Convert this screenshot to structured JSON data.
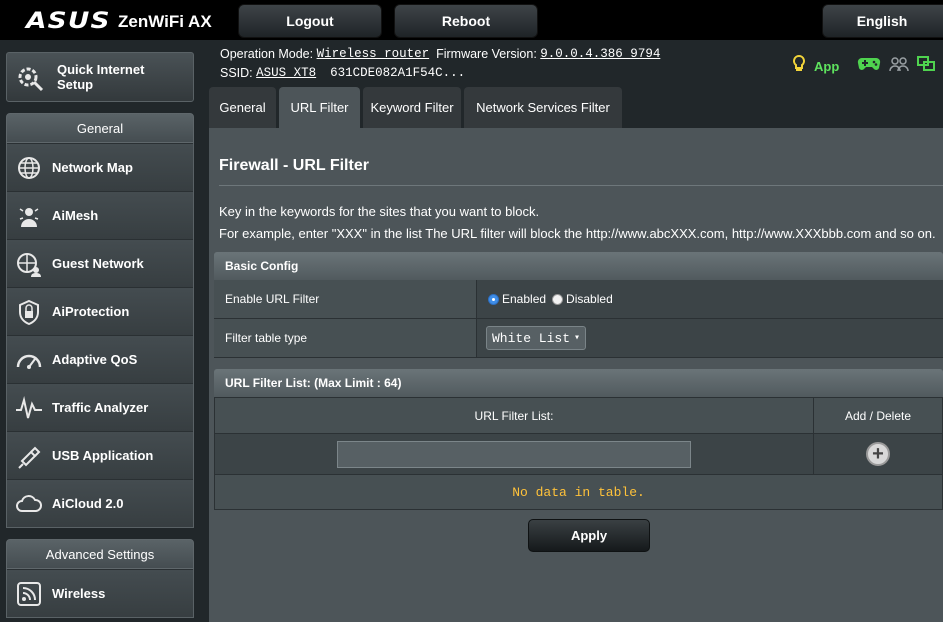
{
  "header": {
    "brand": "ASUS",
    "model": "ZenWiFi AX",
    "logout_label": "Logout",
    "reboot_label": "Reboot",
    "language": "English"
  },
  "info": {
    "op_mode_label": "Operation Mode:",
    "op_mode_value": "Wireless router",
    "firmware_label": "Firmware Version:",
    "firmware_value": "9.0.0.4.386_9794",
    "ssid_label": "SSID:",
    "ssid_value": "ASUS_XT8",
    "ssid_mac": "631CDE082A1F54C...",
    "app_label": "App"
  },
  "sidebar": {
    "qis_label": "Quick Internet Setup",
    "general_head": "General",
    "general_items": [
      {
        "label": "Network Map",
        "icon": "globe-icon"
      },
      {
        "label": "AiMesh",
        "icon": "aimesh-icon"
      },
      {
        "label": "Guest Network",
        "icon": "guest-network-icon"
      },
      {
        "label": "AiProtection",
        "icon": "shield-icon"
      },
      {
        "label": "Adaptive QoS",
        "icon": "speedometer-icon"
      },
      {
        "label": "Traffic Analyzer",
        "icon": "traffic-icon"
      },
      {
        "label": "USB Application",
        "icon": "usb-icon"
      },
      {
        "label": "AiCloud 2.0",
        "icon": "cloud-icon"
      }
    ],
    "advanced_head": "Advanced Settings",
    "advanced_items": [
      {
        "label": "Wireless",
        "icon": "wifi-icon"
      }
    ]
  },
  "tabs": [
    {
      "label": "General"
    },
    {
      "label": "URL Filter"
    },
    {
      "label": "Keyword Filter"
    },
    {
      "label": "Network Services Filter"
    }
  ],
  "main": {
    "title": "Firewall - URL Filter",
    "desc_line1": "Key in the keywords for the sites that you want to block.",
    "desc_line2": "For example, enter \"XXX\" in the list The URL filter will block the http://www.abcXXX.com, http://www.XXXbbb.com and so on.",
    "basic_config": {
      "head": "Basic Config",
      "enable_label": "Enable URL Filter",
      "enabled_option": "Enabled",
      "disabled_option": "Disabled",
      "selected": "Enabled",
      "filter_type_label": "Filter table type",
      "filter_type_value": "White List"
    },
    "list": {
      "head": "URL Filter List: (Max Limit : 64)",
      "col_url": "URL Filter List:",
      "col_action": "Add / Delete",
      "input_value": "",
      "empty_message": "No data in table."
    },
    "apply_label": "Apply"
  }
}
